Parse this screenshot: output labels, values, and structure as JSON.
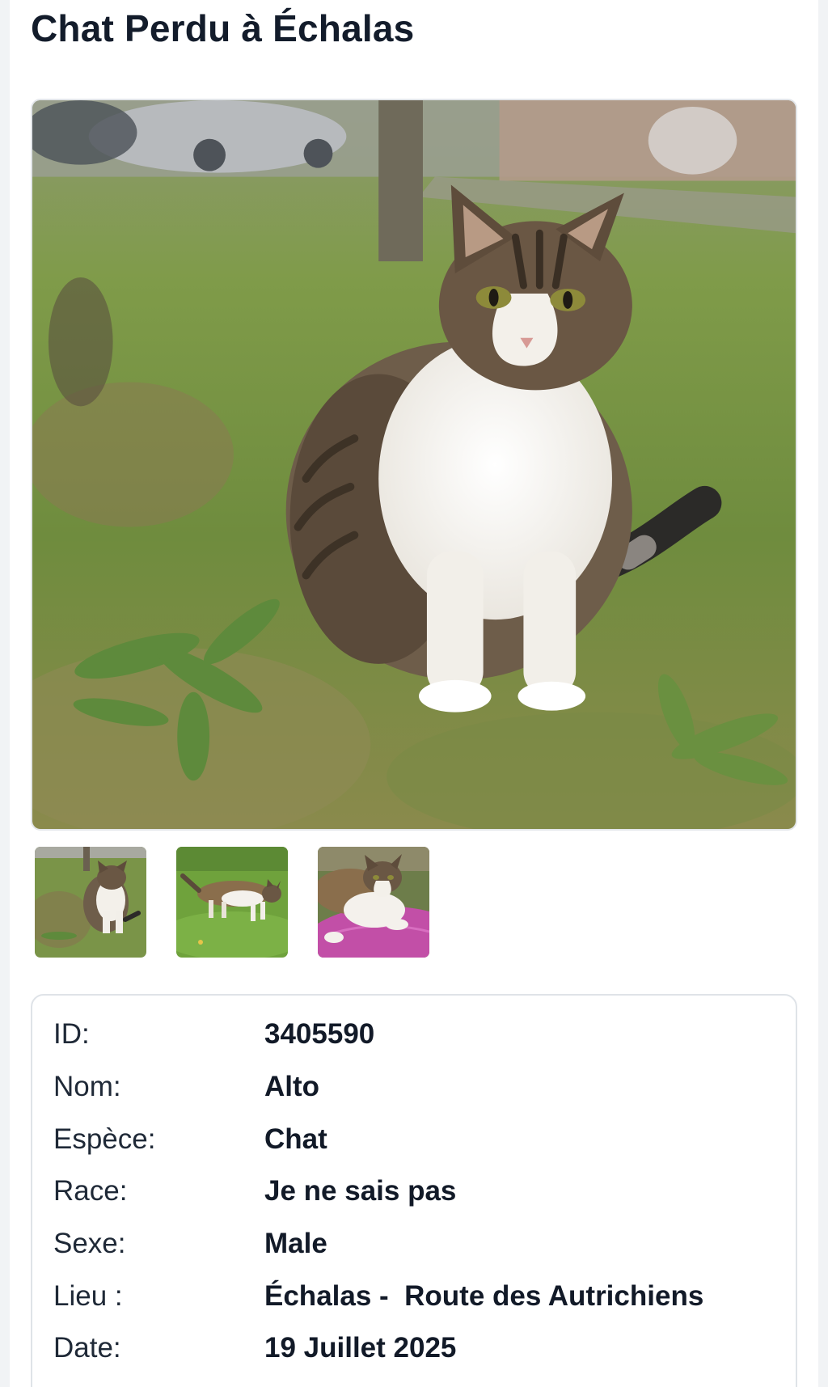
{
  "page": {
    "title": "Chat Perdu à Échalas"
  },
  "gallery": {
    "main_image": "tabby-white-cat-sitting-on-grass",
    "thumbnails": [
      "tabby-white-cat-sitting-on-grass",
      "tabby-cat-walking-on-grass",
      "cat-lying-on-pink-mat"
    ]
  },
  "details": {
    "rows": [
      {
        "label": "ID:",
        "value": "3405590"
      },
      {
        "label": "Nom:",
        "value": "Alto"
      },
      {
        "label": "Espèce:",
        "value": "Chat"
      },
      {
        "label": "Race:",
        "value": "Je ne sais pas"
      },
      {
        "label": "Sexe:",
        "value": "Male"
      },
      {
        "label": "Lieu :",
        "value": "Échalas -  Route des Autrichiens"
      },
      {
        "label": "Date:",
        "value": "19 Juillet 2025"
      }
    ]
  },
  "colors": {
    "title": "#131c2b",
    "card_border": "#dfe3e8",
    "grass": "#7e9a46",
    "cat_white": "#f4f1ec",
    "cat_tabby": "#6e5d4a"
  }
}
